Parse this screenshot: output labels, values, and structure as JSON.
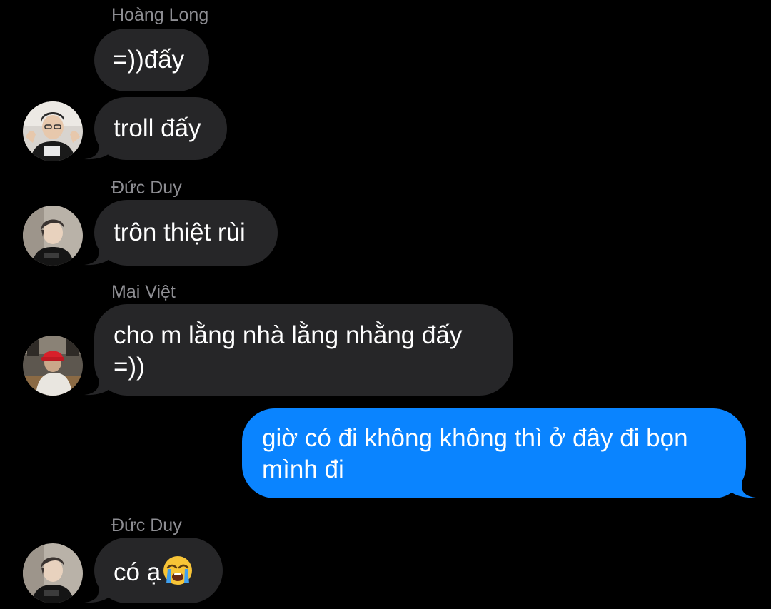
{
  "messages": [
    {
      "sender": "Hoàng Long",
      "text": "=))đấy"
    },
    {
      "text": "troll đấy",
      "avatar": "avatar-hoang-long"
    },
    {
      "sender": "Đức Duy",
      "text": "trôn thiệt rùi",
      "avatar": "avatar-duc-duy"
    },
    {
      "sender": "Mai Việt",
      "text_line1": "cho m lằng nhà lằng nhằng đấy",
      "text_line2": "=))",
      "avatar": "avatar-mai-viet"
    },
    {
      "outgoing": true,
      "text_line1": "giờ có đi không không thì ở đây đi bọn",
      "text_line2": "mình đi"
    },
    {
      "sender": "Đức Duy",
      "text": "có ạ",
      "emoji": "loudly-crying-face-icon",
      "avatar": "avatar-duc-duy"
    }
  ],
  "colors": {
    "background": "#000000",
    "incoming_bubble": "#262628",
    "outgoing_bubble": "#0a84ff",
    "sender_name": "#8e8e93",
    "text": "#ffffff"
  }
}
